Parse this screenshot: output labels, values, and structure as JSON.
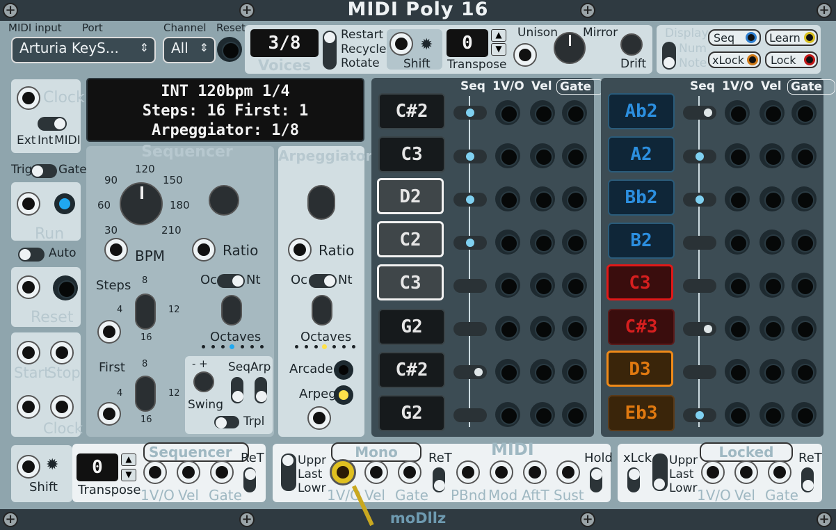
{
  "module": {
    "title": "MIDI Poly 16",
    "brand": "moDllz"
  },
  "midi_input": {
    "label": "MIDI input",
    "port_label": "Port",
    "port_value": "Arturia KeyS...",
    "channel_label": "Channel",
    "channel_value": "All",
    "reset_label": "Reset"
  },
  "voices": {
    "value": "3/8",
    "label": "Voices",
    "options": [
      "Restart",
      "Recycle",
      "Rotate"
    ]
  },
  "shift": {
    "label": "Shift"
  },
  "transpose": {
    "value": "0",
    "label": "Transpose"
  },
  "unison": {
    "unison_label": "Unison",
    "mirror_label": "Mirror",
    "drift_label": "Drift"
  },
  "display_opts": {
    "display_label": "Display",
    "num_label": "Num",
    "note_label": "Note",
    "seq_label": "Seq",
    "xlock_label": "xLock",
    "learn_label": "Learn",
    "lock_label": "Lock"
  },
  "clock": {
    "label": "Clock",
    "ext_label": "Ext",
    "int_label": "Int",
    "midi_label": "MIDI",
    "trig_label": "Trig",
    "gate_label": "Gate",
    "run_label": "Run",
    "auto_label": "Auto",
    "reset_label": "Reset",
    "start_label": "Start",
    "stop_label": "Stop",
    "clock_label": "Clock"
  },
  "lcd": {
    "line1": "INT 120bpm 1/4",
    "line2": "Steps: 16 First: 1",
    "line3": "Arpeggiator: 1/8"
  },
  "sequencer": {
    "title": "Sequencer",
    "bpm_ticks": [
      "120",
      "90",
      "150",
      "60",
      "180",
      "30",
      "210"
    ],
    "bpm_label": "BPM",
    "ratio_label": "Ratio",
    "steps_label": "Steps",
    "steps_ticks": [
      "8",
      "4",
      "12",
      "16"
    ],
    "first_label": "First",
    "first_ticks": [
      "8",
      "4",
      "12",
      "16"
    ],
    "oc_label": "Oc",
    "nt_label": "Nt",
    "octaves_label": "Octaves",
    "swing_label": "Swing",
    "seq_label": "Seq",
    "arp_label": "Arp",
    "trpl_label": "Trpl",
    "minus_plus": "- +"
  },
  "arpeggiator": {
    "title": "Arpeggiator",
    "ratio_label": "Ratio",
    "oc_label": "Oc",
    "nt_label": "Nt",
    "octaves_label": "Octaves",
    "arcade_label": "Arcade",
    "arpeg_label": "Arpeg"
  },
  "voice_headers": {
    "seq": "Seq",
    "v1": "1V/O",
    "vel": "Vel",
    "gate": "Gate"
  },
  "left_notes": [
    "C#2",
    "C3",
    "D2",
    "C2",
    "C3",
    "G2",
    "C#2",
    "G2"
  ],
  "right_notes": [
    "Ab2",
    "A2",
    "Bb2",
    "B2",
    "C3",
    "C#3",
    "D3",
    "Eb3"
  ],
  "bottom": {
    "shift_label": "Shift",
    "transpose_value": "0",
    "transpose_label": "Transpose",
    "seq_title": "Sequencer",
    "ret": "ReT",
    "v1": "1V/O",
    "vel": "Vel",
    "gate": "Gate",
    "mono_title": "Mono",
    "midi_title": "MIDI",
    "uppr": "Uppr",
    "last": "Last",
    "lowr": "Lowr",
    "pbnd": "PBnd",
    "mod": "Mod",
    "aft": "AftT",
    "sust": "Sust",
    "hold": "Hold",
    "xlck": "xLck",
    "locked_title": "Locked"
  },
  "colors": {
    "accent_blue": "#7fd0f0",
    "accent_yellow": "#ffe14a",
    "red": "#e01818",
    "orange": "#f08a18"
  }
}
